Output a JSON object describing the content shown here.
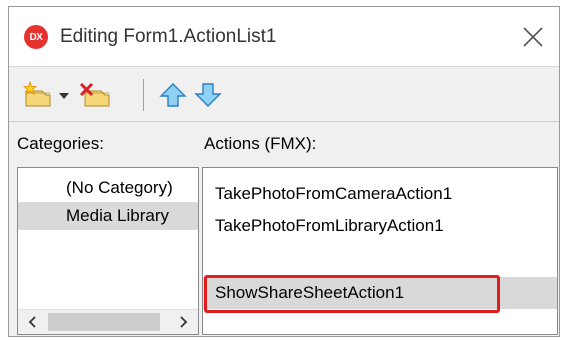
{
  "window": {
    "app_icon_text": "DX",
    "title": "Editing Form1.ActionList1"
  },
  "toolbar": {
    "items": [
      {
        "name": "new-action",
        "icon": "new-action-star-icon"
      },
      {
        "name": "new-action-dropdown",
        "icon": "chevron-down-icon"
      },
      {
        "name": "delete-action",
        "icon": "delete-action-icon"
      },
      {
        "name": "move-up",
        "icon": "arrow-up-icon"
      },
      {
        "name": "move-down",
        "icon": "arrow-down-icon"
      }
    ]
  },
  "categories": {
    "label": "Categories:",
    "items": [
      {
        "label": "(No Category)",
        "selected": false
      },
      {
        "label": "Media Library",
        "selected": true
      }
    ]
  },
  "actions": {
    "label": "Actions (FMX):",
    "items": [
      {
        "label": "TakePhotoFromCameraAction1",
        "selected": false
      },
      {
        "label": "TakePhotoFromLibraryAction1",
        "selected": false
      },
      {
        "label": "ShowShareSheetAction1",
        "selected": true
      }
    ]
  },
  "colors": {
    "highlight_box": "#e01e1e",
    "app_icon": "#e5322d",
    "selection": "#d9d9d9"
  }
}
